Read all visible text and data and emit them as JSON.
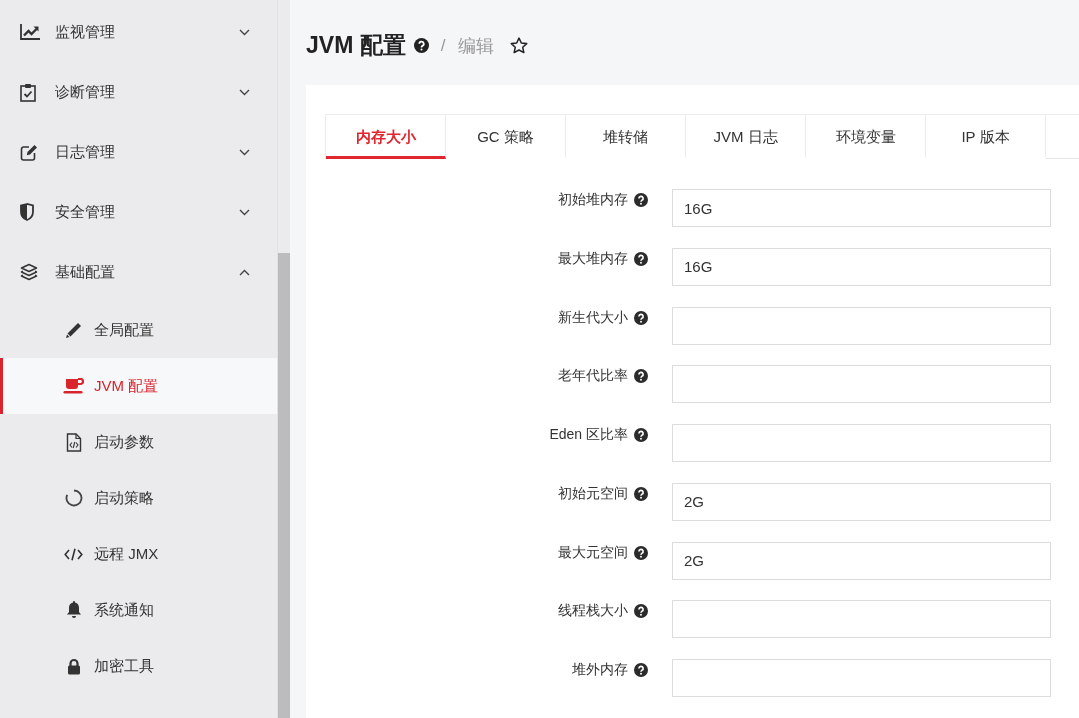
{
  "sidebar": {
    "items": [
      {
        "label": "监视管理",
        "expanded": false
      },
      {
        "label": "诊断管理",
        "expanded": false
      },
      {
        "label": "日志管理",
        "expanded": false
      },
      {
        "label": "安全管理",
        "expanded": false
      },
      {
        "label": "基础配置",
        "expanded": true,
        "children": [
          {
            "label": "全局配置",
            "selected": false
          },
          {
            "label": "JVM 配置",
            "selected": true
          },
          {
            "label": "启动参数",
            "selected": false
          },
          {
            "label": "启动策略",
            "selected": false
          },
          {
            "label": "远程 JMX",
            "selected": false
          },
          {
            "label": "系统通知",
            "selected": false
          },
          {
            "label": "加密工具",
            "selected": false
          }
        ]
      }
    ]
  },
  "page_header": {
    "title": "JVM 配置",
    "separator": "/",
    "breadcrumb": "编辑",
    "starred": false
  },
  "tabs": [
    {
      "label": "内存大小",
      "selected": true
    },
    {
      "label": "GC 策略",
      "selected": false
    },
    {
      "label": "堆转储",
      "selected": false
    },
    {
      "label": "JVM 日志",
      "selected": false
    },
    {
      "label": "环境变量",
      "selected": false
    },
    {
      "label": "IP 版本",
      "selected": false
    }
  ],
  "form": {
    "fields": [
      {
        "label": "初始堆内存",
        "value": "16G"
      },
      {
        "label": "最大堆内存",
        "value": "16G"
      },
      {
        "label": "新生代大小"
      },
      {
        "label": "老年代比率"
      },
      {
        "label": "Eden 区比率"
      },
      {
        "label": "初始元空间",
        "value": "2G"
      },
      {
        "label": "最大元空间",
        "value": "2G"
      },
      {
        "label": "线程栈大小"
      },
      {
        "label": "堆外内存"
      }
    ]
  }
}
